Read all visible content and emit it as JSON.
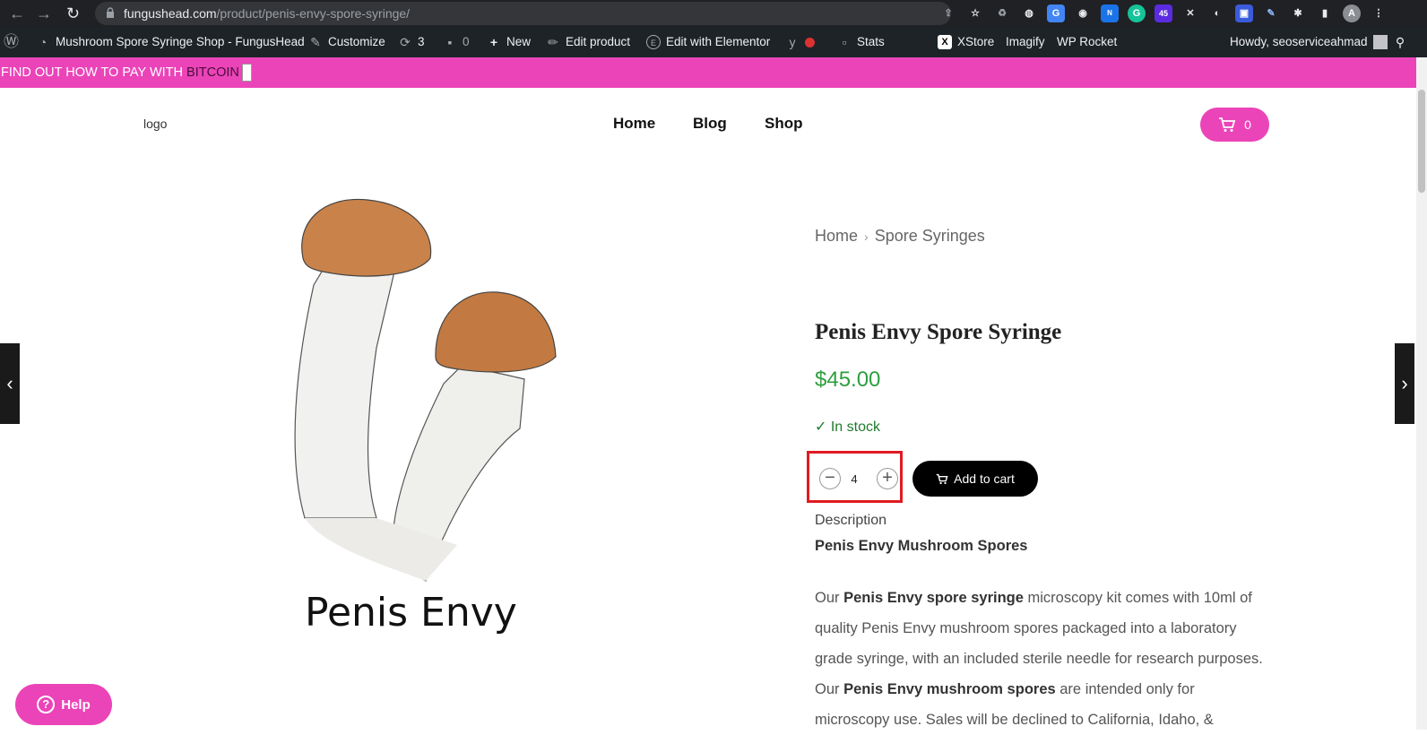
{
  "browser": {
    "url_domain": "fungushead.com",
    "url_path": "/product/penis-envy-spore-syringe/"
  },
  "admin_bar": {
    "site_name": "Mushroom Spore Syringe Shop - FungusHead",
    "customize": "Customize",
    "updates_count": "3",
    "comments_count": "0",
    "new": "New",
    "edit_product": "Edit product",
    "edit_elementor": "Edit with Elementor",
    "stats": "Stats",
    "xstore": "XStore",
    "imagify": "Imagify",
    "wp_rocket": "WP Rocket",
    "howdy": "Howdy, seoserviceahmad"
  },
  "promo": {
    "text": "FIND OUT HOW TO PAY WITH ",
    "link": "BITCOIN"
  },
  "header": {
    "logo_alt": "logo",
    "menu": [
      "Home",
      "Blog",
      "Shop"
    ],
    "cart_count": "0"
  },
  "product": {
    "breadcrumb": [
      "Home",
      "Spore Syringes"
    ],
    "title": "Penis Envy Spore Syringe",
    "price": "$45.00",
    "stock": "In stock",
    "quantity": "4",
    "add_to_cart": "Add to cart",
    "image_caption": "Penis Envy"
  },
  "description": {
    "label": "Description",
    "heading": "Penis Envy Mushroom Spores",
    "p_parts": [
      "Our ",
      "Penis Envy spore syringe",
      " microscopy kit comes with 10ml of quality Penis Envy mushroom spores packaged into a laboratory grade syringe, with an included sterile needle for research purposes. Our ",
      "Penis Envy mushroom spores",
      " are intended only for microscopy use. Sales will be declined to California, Idaho, &"
    ]
  },
  "help": {
    "label": "Help"
  },
  "colors": {
    "accent": "#eb44b8",
    "price": "#2e9e3e",
    "highlight": "#e01a22"
  }
}
